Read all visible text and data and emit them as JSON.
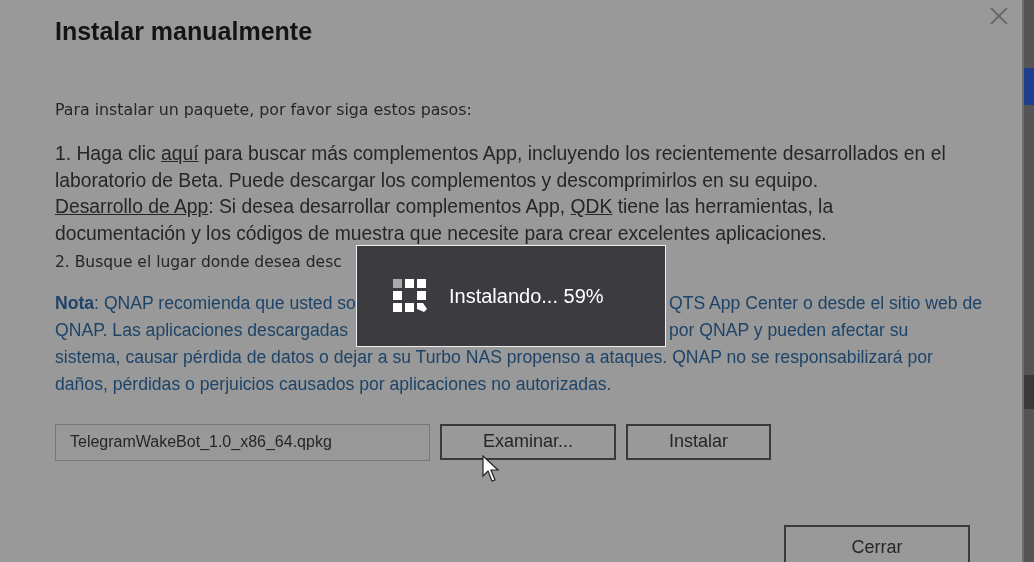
{
  "dialog": {
    "title": "Instalar manualmente",
    "intro": "Para instalar un paquete, por favor siga estos pasos:",
    "step_1": [
      [
        {
          "kind": "text",
          "text": "1. Haga clic "
        },
        {
          "kind": "link",
          "text": "aquí"
        },
        {
          "kind": "text",
          "text": " para buscar más complementos App, incluyendo los recientemente desarrollados en el"
        }
      ],
      [
        {
          "kind": "text",
          "text": "laboratorio de Beta. Puede descargar los complementos y descomprimirlos en su equipo."
        }
      ],
      [
        {
          "kind": "link",
          "text": "Desarrollo de App"
        },
        {
          "kind": "text",
          "text": ": Si desea desarrollar complementos App, "
        },
        {
          "kind": "link",
          "text": "QDK"
        },
        {
          "kind": "text",
          "text": " tiene las herramientas, la"
        }
      ],
      [
        {
          "kind": "text",
          "text": "documentación y los códigos de muestra que necesite para crear excelentes aplicaciones."
        }
      ]
    ],
    "step_2": "2. Busque el lugar donde desea desc",
    "note_lines": [
      {
        "left": "**Nota**: QNAP recomienda que usted so",
        "right": "QTS App Center o desde el sitio web de"
      },
      {
        "left": "QNAP. Las aplicaciones descargadas",
        "right": "por QNAP y pueden afectar su"
      },
      {
        "left": "sistema, causar pérdida de datos o dejar a su Turbo NAS propenso a ataques. QNAP no se responsabilizará por"
      },
      {
        "left": "daños, pérdidas o perjuicios causados por aplicaciones no autorizadas."
      }
    ],
    "file_field": {
      "value": "TelegramWakeBot_1.0_x86_64.qpkg"
    },
    "browse_button": "Examinar...",
    "install_button": "Instalar",
    "close_button": "Cerrar"
  },
  "progress_toast": {
    "text": "Instalando... 59%"
  }
}
